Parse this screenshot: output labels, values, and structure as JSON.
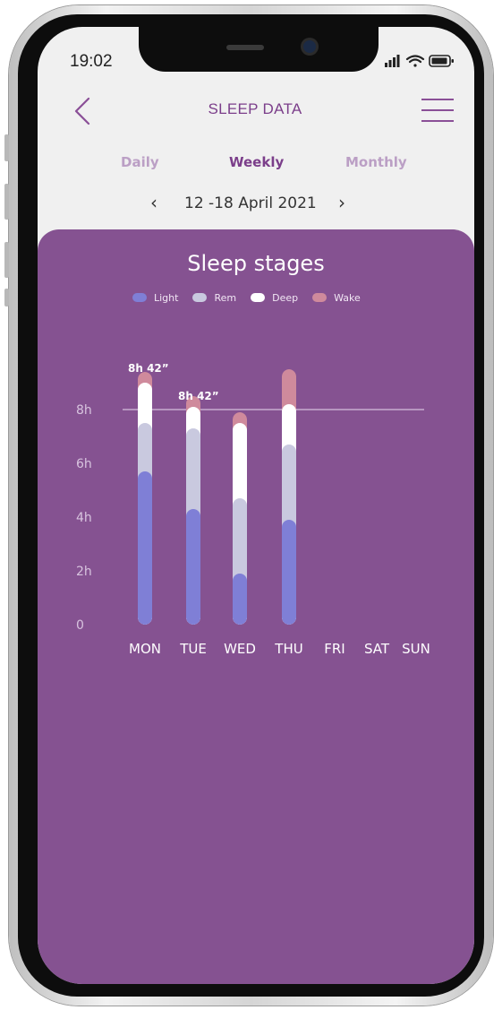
{
  "status_bar": {
    "time": "19:02"
  },
  "header": {
    "title": "SLEEP DATA"
  },
  "tabs": [
    {
      "label": "Daily",
      "active": false
    },
    {
      "label": "Weekly",
      "active": true
    },
    {
      "label": "Monthly",
      "active": false
    }
  ],
  "date_range": {
    "label": "12 -18 April 2021",
    "prev_icon": "chevron-left-icon",
    "next_icon": "chevron-right-icon"
  },
  "colors": {
    "purple": "#855291",
    "light": "#7f7fd6",
    "rem": "#c9c9df",
    "deep": "#ffffff",
    "wake": "#cf8a9c"
  },
  "chart_data": {
    "type": "bar",
    "stacked": true,
    "title": "Sleep stages",
    "categories": [
      "MON",
      "TUE",
      "WED",
      "THU",
      "FRI",
      "SAT",
      "SUN"
    ],
    "y_ticks": [
      "0",
      "2h",
      "4h",
      "6h",
      "8h"
    ],
    "ylim": [
      0,
      9.5
    ],
    "reference_line": 8,
    "legend": [
      "Light",
      "Rem",
      "Deep",
      "Wake"
    ],
    "series": [
      {
        "name": "Light",
        "values": [
          5.7,
          4.3,
          1.9,
          3.9,
          0,
          0,
          0
        ]
      },
      {
        "name": "Rem",
        "values": [
          1.8,
          3.0,
          2.8,
          2.8,
          0,
          0,
          0
        ]
      },
      {
        "name": "Deep",
        "values": [
          1.5,
          0.8,
          2.8,
          1.5,
          0,
          0,
          0
        ]
      },
      {
        "name": "Wake",
        "values": [
          0.4,
          0.4,
          0.4,
          1.3,
          0,
          0,
          0
        ]
      }
    ],
    "data_labels": [
      {
        "category": "MON",
        "text": "8h 42”"
      },
      {
        "category": "TUE",
        "text": "8h 42”"
      }
    ]
  }
}
